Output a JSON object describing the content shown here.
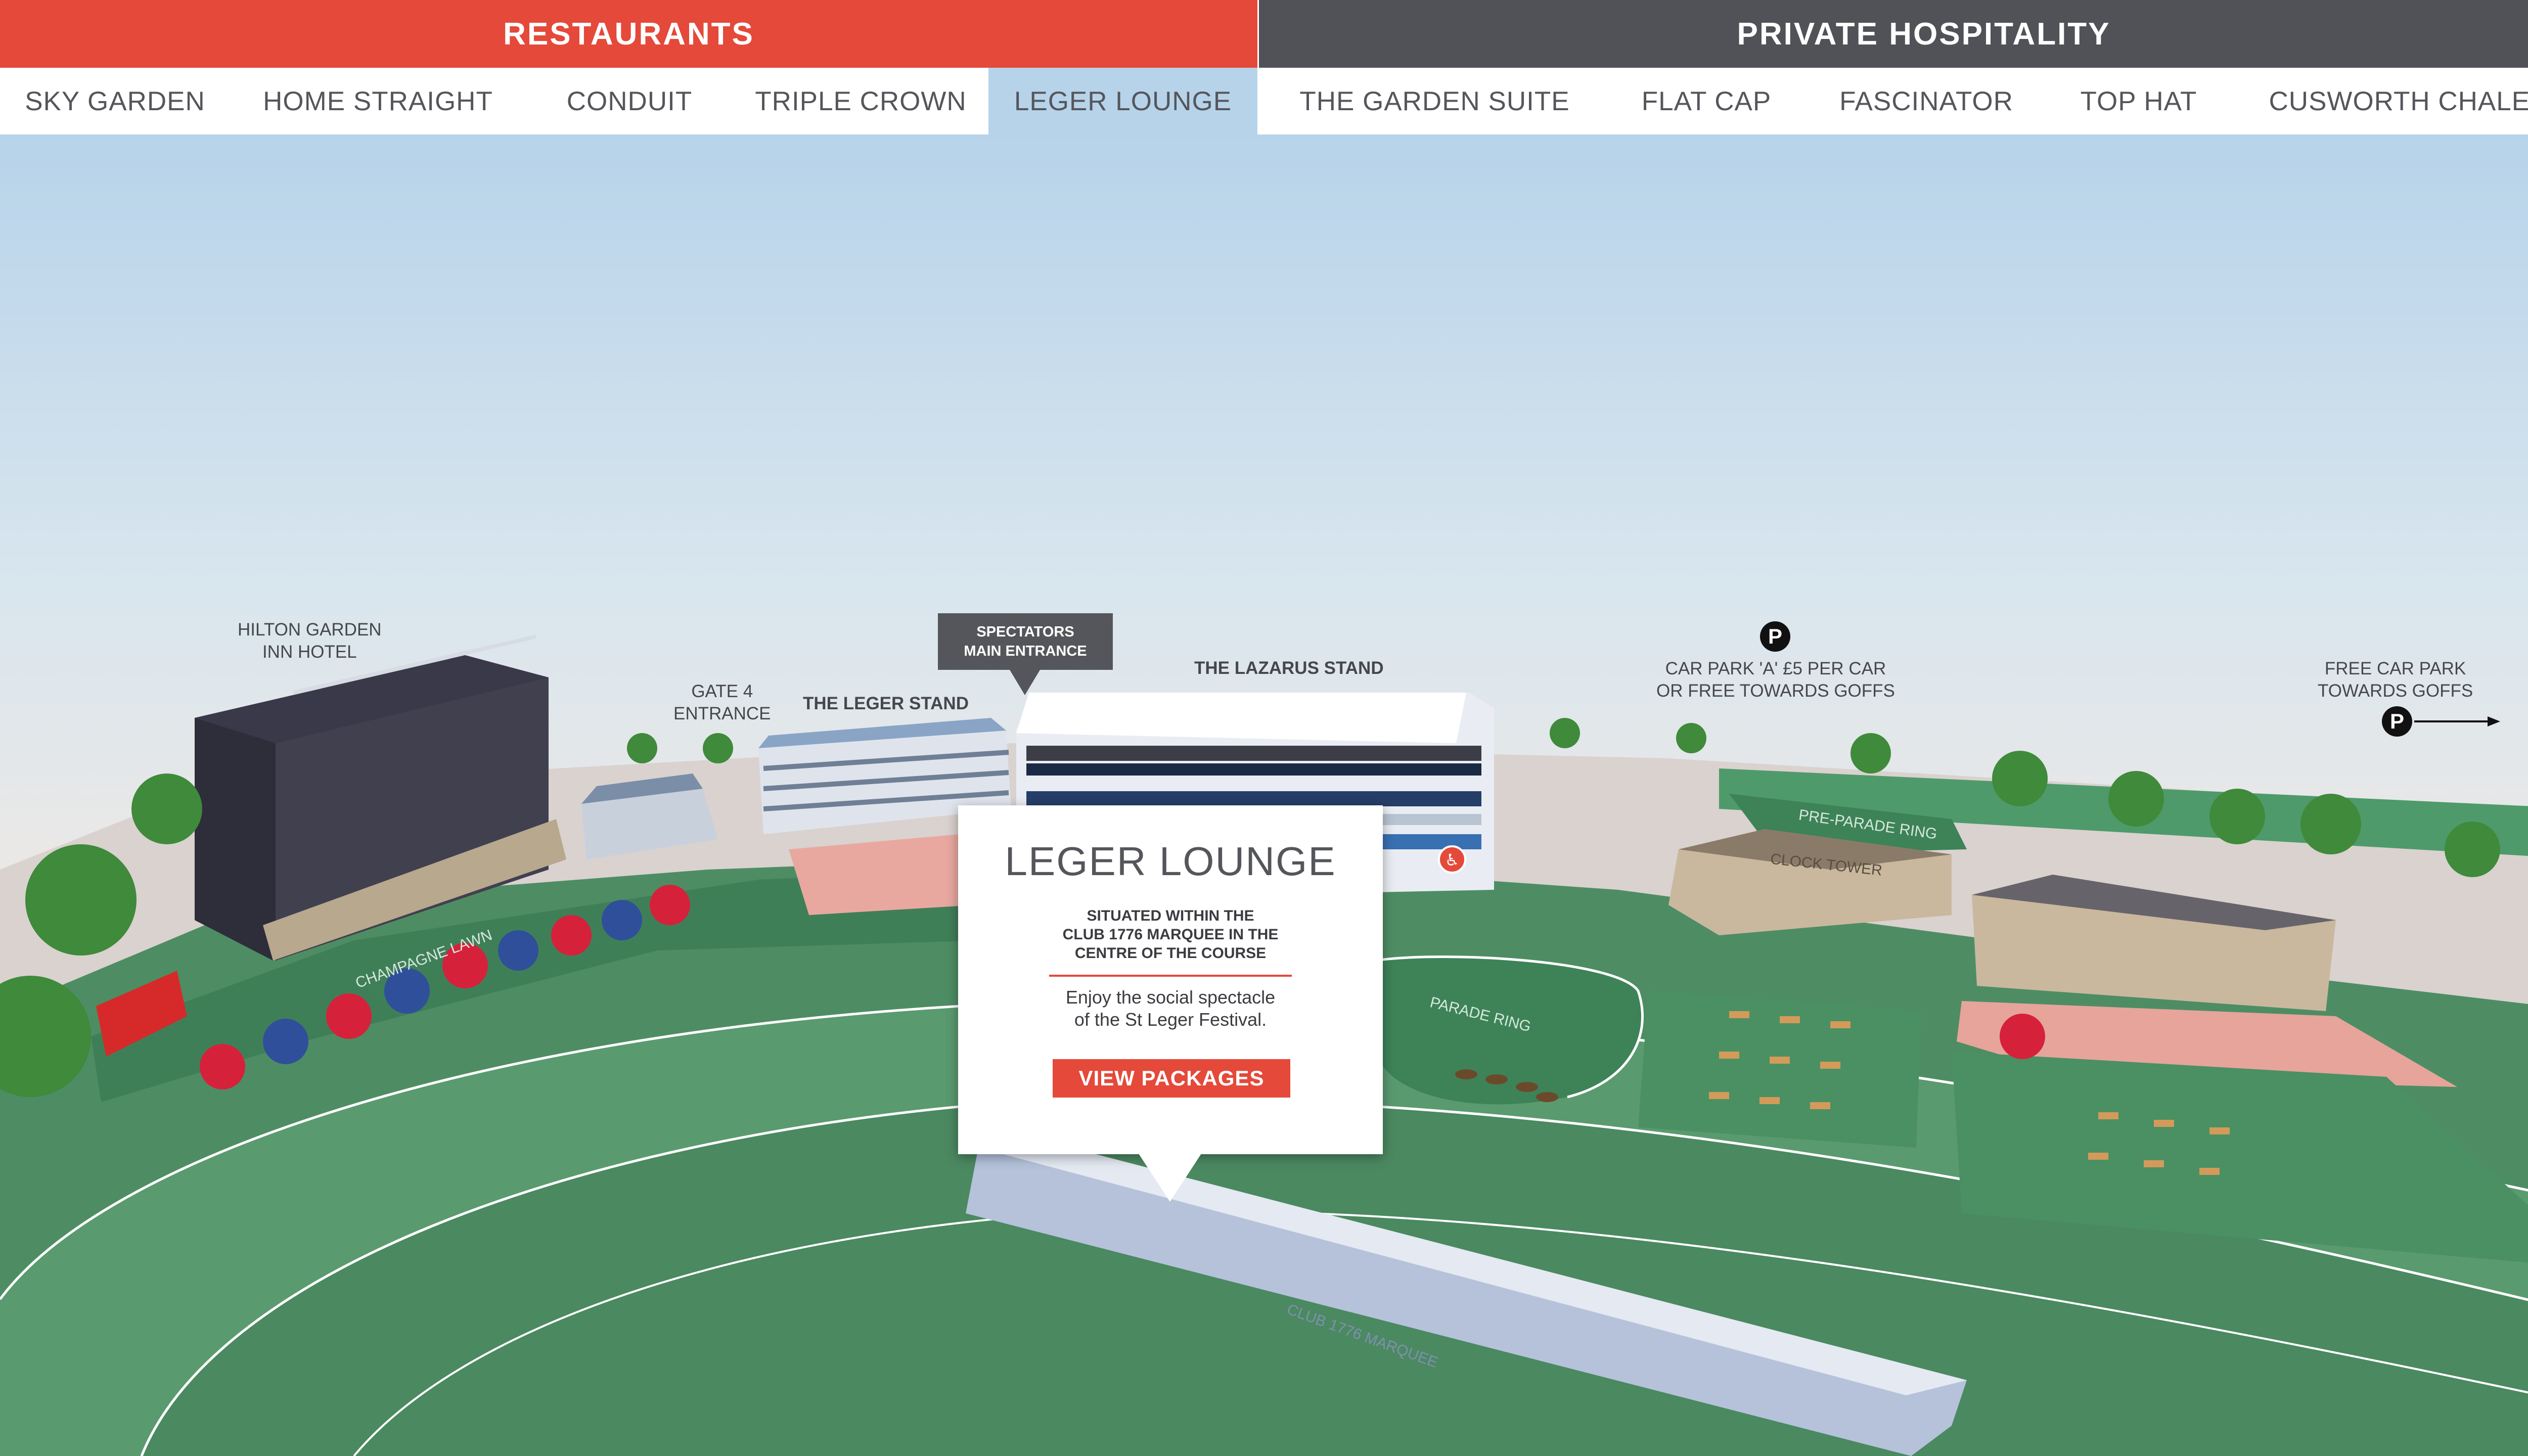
{
  "headers": {
    "restaurants": "RESTAURANTS",
    "private_hospitality": "PRIVATE HOSPITALITY"
  },
  "restaurant_tabs": [
    "SKY GARDEN",
    "HOME STRAIGHT",
    "CONDUIT",
    "TRIPLE CROWN",
    "LEGER LOUNGE"
  ],
  "hospitality_tabs": [
    "THE GARDEN SUITE",
    "FLAT CAP",
    "FASCINATOR",
    "TOP HAT",
    "CUSWORTH CHALET"
  ],
  "active_tab": "LEGER LOUNGE",
  "map_labels": {
    "hilton": "HILTON GARDEN\nINN HOTEL",
    "gate4": "GATE 4\nENTRANCE",
    "leger_stand": "THE LEGER STAND",
    "spectators": "SPECTATORS\nMAIN ENTRANCE",
    "lazarus_stand": "THE LAZARUS STAND",
    "car_park_a": "CAR PARK 'A' £5 PER CAR\nOR FREE TOWARDS GOFFS",
    "free_car_park": "FREE CAR PARK\nTOWARDS GOFFS",
    "parking_symbol": "P",
    "champagne_lawn": "CHAMPAGNE LAWN",
    "pre_parade_ring": "PRE-PARADE RING",
    "clock_tower": "CLOCK TOWER",
    "parade_ring": "PARADE RING",
    "club_marquee": "CLUB 1776 MARQUEE"
  },
  "popup": {
    "title": "LEGER LOUNGE",
    "subtitle": "SITUATED WITHIN THE\nCLUB 1776 MARQUEE IN THE\nCENTRE OF THE COURSE",
    "body": "Enjoy the social spectacle\nof the St Leger Festival.",
    "button": "VIEW PACKAGES"
  },
  "colors": {
    "accent_red": "#e4493a",
    "header_dark": "#515257",
    "sky": "#b8d4ea",
    "grass": "#4f9367",
    "track": "#5c9a70"
  },
  "icons": [
    "parking-icon",
    "arrow-right-icon",
    "accessible-icon"
  ]
}
